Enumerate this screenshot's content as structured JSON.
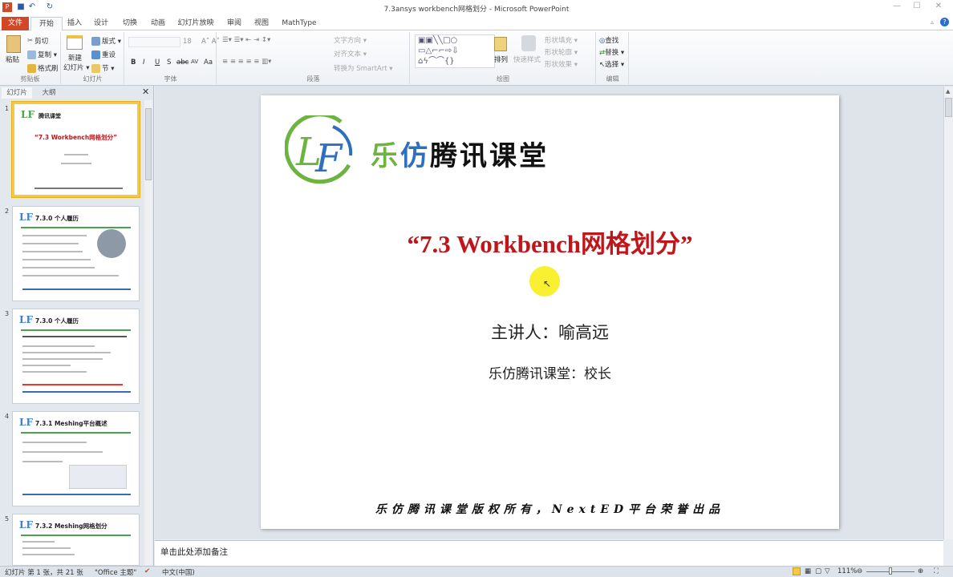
{
  "window": {
    "title": "7.3ansys workbench网格划分 - Microsoft PowerPoint",
    "app_icon": "P"
  },
  "tabs": [
    "文件",
    "开始",
    "插入",
    "设计",
    "切换",
    "动画",
    "幻灯片放映",
    "审阅",
    "视图",
    "MathType"
  ],
  "ribbon": {
    "clipboard": {
      "paste": "粘贴",
      "cut": "剪切",
      "copy": "复制 ▾",
      "format_painter": "格式刷",
      "label": "剪贴板"
    },
    "slides": {
      "new_slide_1": "新建",
      "new_slide_2": "幻灯片 ▾",
      "layout": "版式 ▾",
      "reset": "重设",
      "section": "节 ▾",
      "label": "幻灯片"
    },
    "font": {
      "size": "18",
      "bold": "B",
      "italic": "I",
      "underline": "U",
      "strike": "S",
      "abc": "abc",
      "spacing": "AV",
      "case": "Aa",
      "color": "A",
      "label": "字体"
    },
    "paragraph": {
      "text_direction": "文字方向 ▾",
      "align_text": "对齐文本 ▾",
      "smartart": "转换为 SmartArt ▾",
      "label": "段落"
    },
    "drawing": {
      "arrange": "排列",
      "quick_styles": "快速样式",
      "fill": "形状填充 ▾",
      "outline": "形状轮廓 ▾",
      "effects": "形状效果 ▾",
      "label": "绘图"
    },
    "editing": {
      "find": "查找",
      "replace": "替换 ▾",
      "select": "选择 ▾",
      "label": "编辑"
    }
  },
  "pane": {
    "tabs": [
      "幻灯片",
      "大纲"
    ],
    "thumbnails": [
      {
        "num": "1",
        "title": "“7.3 Workbench网格划分”"
      },
      {
        "num": "2",
        "title": "7.3.0 个人履历"
      },
      {
        "num": "3",
        "title": "7.3.0 个人履历"
      },
      {
        "num": "4",
        "title": "7.3.1 Meshing平台概述"
      },
      {
        "num": "5",
        "title": "7.3.2 Meshing网格划分"
      }
    ]
  },
  "slide": {
    "brand": [
      "乐",
      "仿",
      "腾讯课堂"
    ],
    "title": "“7.3 Workbench网格划分”",
    "speaker": "主讲人：喻高远",
    "role": "乐仿腾讯课堂：校长",
    "footer": "乐仿腾讯课堂版权所有，NextED平台荣誉出品"
  },
  "notes": {
    "placeholder": "单击此处添加备注"
  },
  "status": {
    "slide_info": "幻灯片 第 1 张，共 21 张",
    "theme": "\"Office 主题\"",
    "language": "中文(中国)",
    "zoom": "111%"
  },
  "colors": {
    "file_tab": "#d24726",
    "title_red": "#c0161b",
    "brand_green": "#6db33f",
    "brand_blue": "#2f6fc0",
    "selection": "#f5c944"
  }
}
